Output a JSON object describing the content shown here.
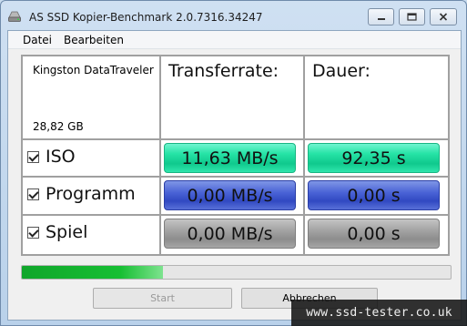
{
  "window": {
    "title": "AS SSD Kopier-Benchmark 2.0.7316.34247"
  },
  "menu": {
    "items": [
      {
        "label": "Datei"
      },
      {
        "label": "Bearbeiten"
      }
    ]
  },
  "device": {
    "name": "Kingston DataTraveler",
    "size": "28,82 GB"
  },
  "columns": {
    "transfer": "Transferrate:",
    "duration": "Dauer:"
  },
  "rows": [
    {
      "label": "ISO",
      "checked": true,
      "transfer": "11,63 MB/s",
      "duration": "92,35 s",
      "color": "#26e3a6"
    },
    {
      "label": "Programm",
      "checked": true,
      "transfer": "0,00 MB/s",
      "duration": "0,00 s",
      "color": "#4a63d6"
    },
    {
      "label": "Spiel",
      "checked": true,
      "transfer": "0,00 MB/s",
      "duration": "0,00 s",
      "color": "#a2a2a2"
    }
  ],
  "progress": {
    "fraction": 0.33,
    "color": "#17bf33"
  },
  "buttons": {
    "start": "Start",
    "abort": "Abbrechen"
  },
  "watermark": "www.ssd-tester.co.uk"
}
